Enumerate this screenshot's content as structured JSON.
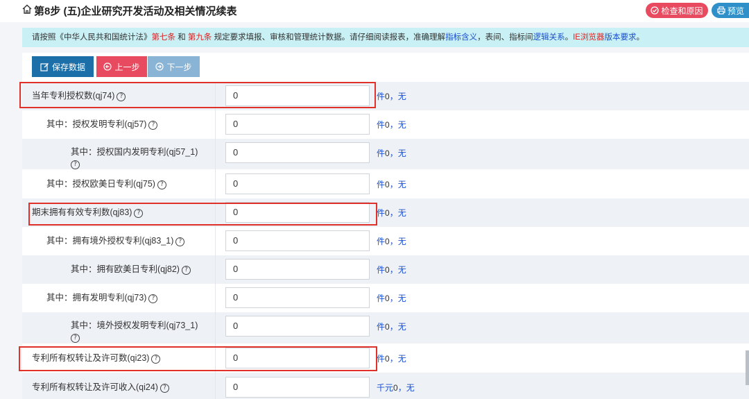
{
  "header": {
    "title": "第8步 (五)企业研究开发活动及相关情况续表",
    "check_btn": "检查和原因",
    "preview_btn": "预览"
  },
  "notice": {
    "p1": "请按照《中华人民共和国统计法》",
    "law1": "第七条",
    "and": " 和 ",
    "law2": "第九条",
    "p2": " 规定要求填报、审核和管理统计数据。请仔细阅读报表，准确理解",
    "link1": "指标含义",
    "p3": "，表间、指标间",
    "link2": "逻辑关系",
    "p4": "。",
    "link3": "IE浏览器",
    "link4": "版本要求",
    "p5": "。"
  },
  "toolbar": {
    "save": "保存数据",
    "prev": "上一步",
    "next": "下一步"
  },
  "rows": [
    {
      "label": "当年专利授权数(qj74)",
      "value": "0",
      "unit": "件",
      "unit_num": "0",
      "unit_note": "，无"
    },
    {
      "label": "其中：授权发明专利(qj57)",
      "value": "0",
      "unit": "件",
      "unit_num": "0",
      "unit_note": "，无"
    },
    {
      "label": "其中：授权国内发明专利(qj57_1)",
      "value": "0",
      "unit": "件",
      "unit_num": "0",
      "unit_note": "，无"
    },
    {
      "label": "其中：授权欧美日专利(qj75)",
      "value": "0",
      "unit": "件",
      "unit_num": "0",
      "unit_note": "，无"
    },
    {
      "label": "期末拥有有效专利数(qj83)",
      "value": "0",
      "unit": "件",
      "unit_num": "0",
      "unit_note": "，无"
    },
    {
      "label": "其中：拥有境外授权专利(qj83_1)",
      "value": "0",
      "unit": "件",
      "unit_num": "0",
      "unit_note": "，无"
    },
    {
      "label": "其中：拥有欧美日专利(qj82)",
      "value": "0",
      "unit": "件",
      "unit_num": "0",
      "unit_note": "，无"
    },
    {
      "label": "其中：拥有发明专利(qj73)",
      "value": "0",
      "unit": "件",
      "unit_num": "0",
      "unit_note": "，无"
    },
    {
      "label": "其中：境外授权发明专利(qj73_1)",
      "value": "0",
      "unit": "件",
      "unit_num": "0",
      "unit_note": "，无"
    },
    {
      "label": "专利所有权转让及许可数(qi23)",
      "value": "0",
      "unit": "件",
      "unit_num": "0",
      "unit_note": "，无"
    },
    {
      "label": "专利所有权转让及许可收入(qi24)",
      "value": "0",
      "unit": "千元",
      "unit_num": "0",
      "unit_note": "，无"
    }
  ],
  "colors": {
    "accent_red": "#e84a5f",
    "accent_blue": "#1c6fa9",
    "highlight_box": "#e0302a",
    "notice_bg": "#c9f0f4"
  }
}
